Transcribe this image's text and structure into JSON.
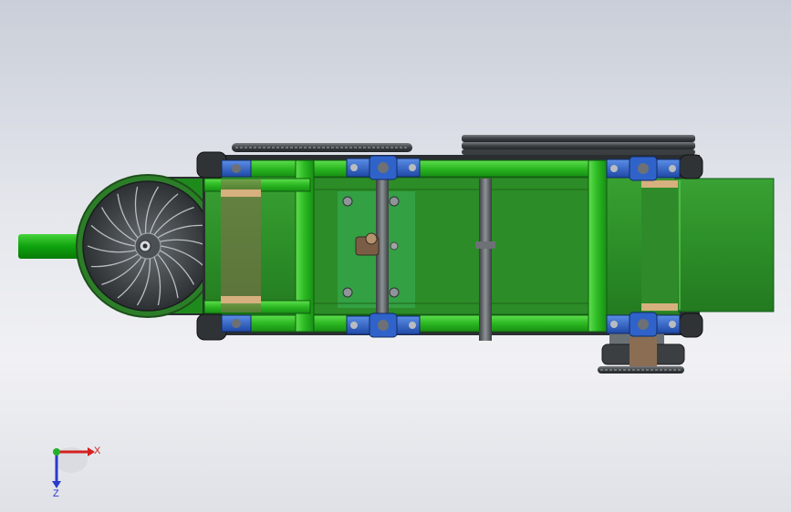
{
  "triad": {
    "x_label": "X",
    "z_label": "Z",
    "x_color": "#d42020",
    "y_color": "#22b02a",
    "z_color": "#2a3acc"
  },
  "colors": {
    "frame_green": "#27b320",
    "panel_green": "#2f9a2a",
    "dark_green": "#1f7f1c",
    "bearing_blue": "#2d63c8",
    "shaft_gray": "#5a5e62",
    "fan_dark": "#3b3f42"
  },
  "icons": {
    "triad": "axis-triad-icon"
  }
}
